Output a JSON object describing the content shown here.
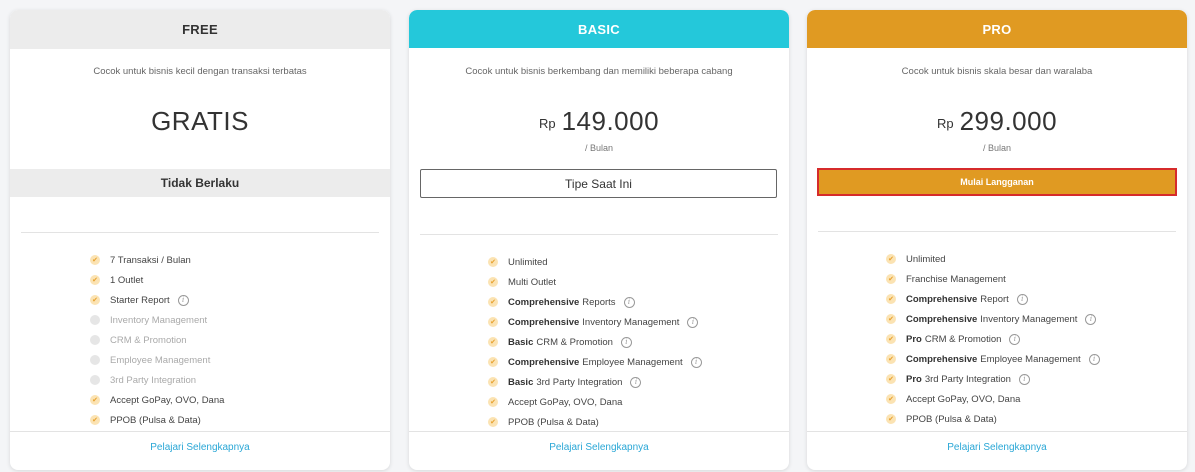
{
  "plans": {
    "free": {
      "name": "FREE",
      "description": "Cocok untuk bisnis kecil dengan transaksi terbatas",
      "price_text": "GRATIS",
      "button_label": "Tidak Berlaku",
      "learn_more": "Pelajari Selengkapnya",
      "features": [
        {
          "bold": "",
          "text": "7 Transaksi / Bulan",
          "enabled": true,
          "info": false
        },
        {
          "bold": "",
          "text": "1 Outlet",
          "enabled": true,
          "info": false
        },
        {
          "bold": "",
          "text": "Starter Report",
          "enabled": true,
          "info": true
        },
        {
          "bold": "",
          "text": "Inventory Management",
          "enabled": false,
          "info": false
        },
        {
          "bold": "",
          "text": "CRM & Promotion",
          "enabled": false,
          "info": false
        },
        {
          "bold": "",
          "text": "Employee Management",
          "enabled": false,
          "info": false
        },
        {
          "bold": "",
          "text": "3rd Party Integration",
          "enabled": false,
          "info": false
        },
        {
          "bold": "",
          "text": "Accept GoPay, OVO, Dana",
          "enabled": true,
          "info": false
        },
        {
          "bold": "",
          "text": "PPOB (Pulsa & Data)",
          "enabled": true,
          "info": false
        }
      ]
    },
    "basic": {
      "name": "BASIC",
      "description": "Cocok untuk bisnis berkembang dan memiliki beberapa cabang",
      "currency": "Rp",
      "amount": "149.000",
      "period": "/ Bulan",
      "button_label": "Tipe Saat Ini",
      "learn_more": "Pelajari Selengkapnya",
      "features": [
        {
          "bold": "",
          "text": "Unlimited",
          "enabled": true,
          "info": false
        },
        {
          "bold": "",
          "text": "Multi Outlet",
          "enabled": true,
          "info": false
        },
        {
          "bold": "Comprehensive",
          "text": "Reports",
          "enabled": true,
          "info": true
        },
        {
          "bold": "Comprehensive",
          "text": "Inventory Management",
          "enabled": true,
          "info": true
        },
        {
          "bold": "Basic",
          "text": "CRM & Promotion",
          "enabled": true,
          "info": true
        },
        {
          "bold": "Comprehensive",
          "text": "Employee Management",
          "enabled": true,
          "info": true
        },
        {
          "bold": "Basic",
          "text": "3rd Party Integration",
          "enabled": true,
          "info": true
        },
        {
          "bold": "",
          "text": "Accept GoPay, OVO, Dana",
          "enabled": true,
          "info": false
        },
        {
          "bold": "",
          "text": "PPOB (Pulsa & Data)",
          "enabled": true,
          "info": false
        }
      ]
    },
    "pro": {
      "name": "PRO",
      "description": "Cocok untuk bisnis skala besar dan waralaba",
      "currency": "Rp",
      "amount": "299.000",
      "period": "/ Bulan",
      "button_label": "Mulai Langganan",
      "learn_more": "Pelajari Selengkapnya",
      "features": [
        {
          "bold": "",
          "text": "Unlimited",
          "enabled": true,
          "info": false
        },
        {
          "bold": "",
          "text": "Franchise Management",
          "enabled": true,
          "info": false
        },
        {
          "bold": "Comprehensive",
          "text": "Report",
          "enabled": true,
          "info": true
        },
        {
          "bold": "Comprehensive",
          "text": "Inventory Management",
          "enabled": true,
          "info": true
        },
        {
          "bold": "Pro",
          "text": "CRM & Promotion",
          "enabled": true,
          "info": true
        },
        {
          "bold": "Comprehensive",
          "text": "Employee Management",
          "enabled": true,
          "info": true
        },
        {
          "bold": "Pro",
          "text": "3rd Party Integration",
          "enabled": true,
          "info": true
        },
        {
          "bold": "",
          "text": "Accept GoPay, OVO, Dana",
          "enabled": true,
          "info": false
        },
        {
          "bold": "",
          "text": "PPOB (Pulsa & Data)",
          "enabled": true,
          "info": false
        }
      ]
    }
  },
  "colors": {
    "free_header": "#ececec",
    "basic_header": "#24c8da",
    "pro_header": "#e09a22",
    "highlight_border": "#d62b2b",
    "link": "#2aa7d6"
  },
  "icons": {
    "check": "check-circle-icon",
    "check_disabled": "check-circle-disabled-icon",
    "info": "info-circle-icon"
  }
}
